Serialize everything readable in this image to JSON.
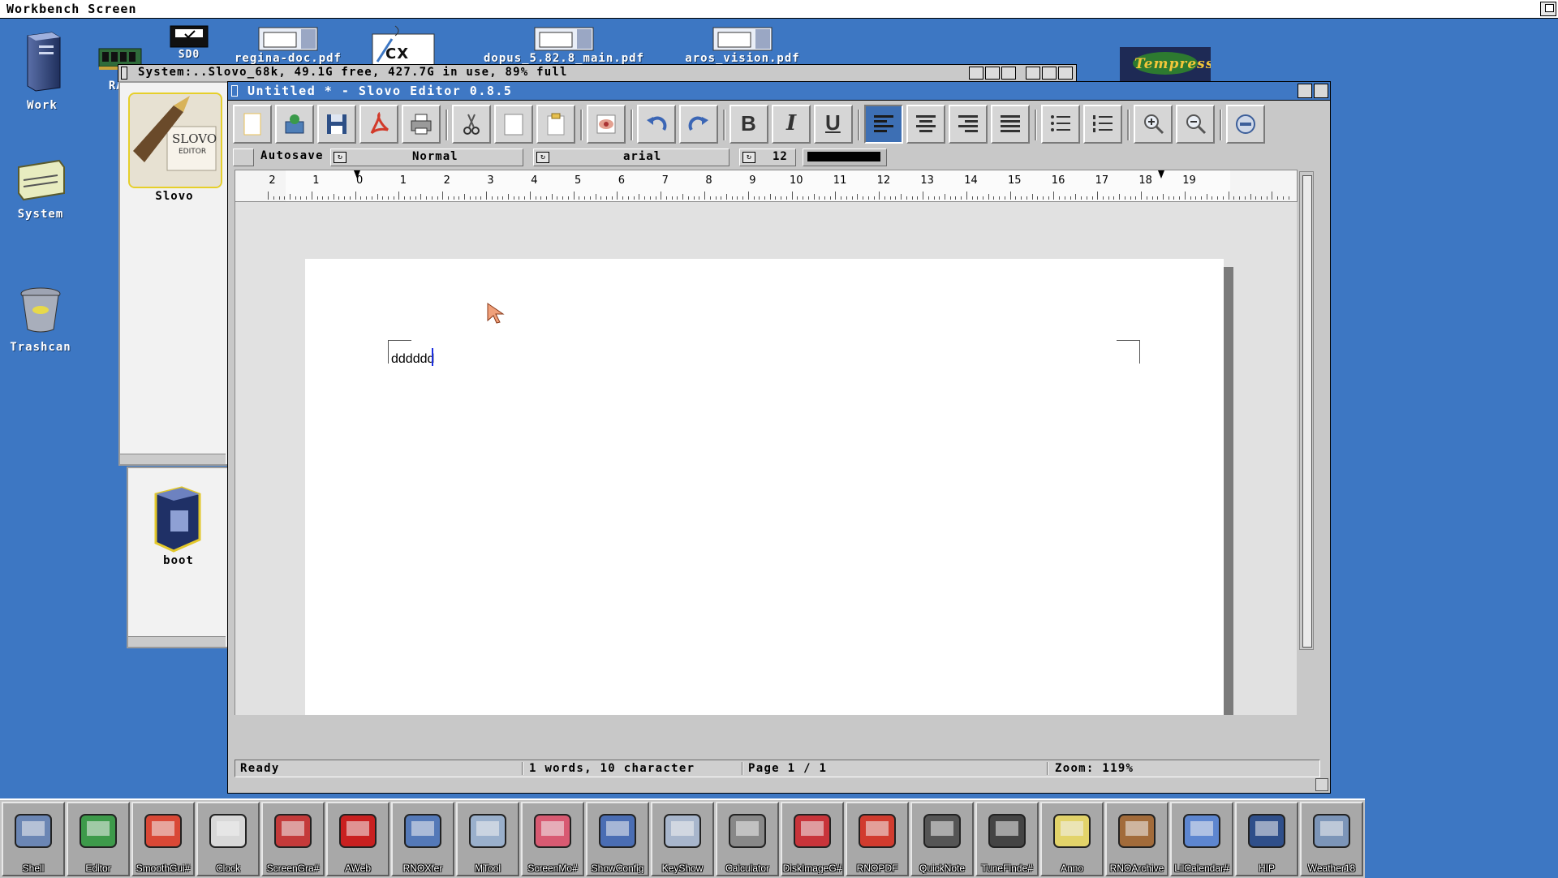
{
  "screen": {
    "title": "Workbench Screen"
  },
  "desktop": {
    "icons": [
      {
        "name": "work",
        "label": "Work"
      },
      {
        "name": "ram",
        "label": "RAM"
      },
      {
        "name": "system",
        "label": "System"
      },
      {
        "name": "trashcan",
        "label": "Trashcan"
      },
      {
        "name": "sd0",
        "label": "SD0"
      },
      {
        "name": "regina-doc",
        "label": "regina-doc.pdf"
      },
      {
        "name": "cx",
        "label": ""
      },
      {
        "name": "dopus",
        "label": "dopus_5.82.8_main.pdf"
      },
      {
        "name": "aros-vision",
        "label": "aros_vision.pdf"
      },
      {
        "name": "tempress",
        "label": "Tempress"
      }
    ]
  },
  "system_window": {
    "title": "System:..Slovo_68k,  49.1G free, 427.7G in use, 89% full"
  },
  "drawers": {
    "slovo": {
      "label": "Slovo",
      "icon_text_top": "SLOVO",
      "icon_text_bottom": "EDITOR"
    },
    "boot": {
      "label": "boot"
    }
  },
  "editor": {
    "title": "Untitled * - Slovo Editor 0.8.5",
    "toolbar": [
      "new-doc-icon",
      "open-icon",
      "save-icon",
      "export-pdf-icon",
      "print-icon",
      "cut-icon",
      "copy-icon",
      "paste-icon",
      "preview-icon",
      "undo-icon",
      "redo-icon",
      "bold-icon",
      "italic-icon",
      "underline-icon",
      "align-left-icon",
      "align-center-icon",
      "align-right-icon",
      "align-justify-icon",
      "bullet-list-icon",
      "numbered-list-icon",
      "zoom-in-icon",
      "zoom-out-icon",
      "settings-icon"
    ],
    "toolbar_glyphs": {
      "bold": "B",
      "italic": "I",
      "underline": "U"
    },
    "format": {
      "autosave_label": "Autosave",
      "style_value": "Normal",
      "font_value": "arial",
      "size_value": "12",
      "text_color": "#000000"
    },
    "ruler": {
      "negative_labels": [
        "2",
        "1"
      ],
      "labels": [
        "0",
        "1",
        "2",
        "3",
        "4",
        "5",
        "6",
        "7",
        "8",
        "9",
        "10",
        "11",
        "12",
        "13",
        "14",
        "15",
        "16",
        "17",
        "18",
        "19"
      ]
    },
    "document": {
      "text": "dddddd"
    },
    "scroll": {
      "up": "∧",
      "down": "V"
    },
    "status": {
      "state": "Ready",
      "counts": "1 words, 10 character",
      "page": "Page 1 / 1",
      "zoom": "Zoom: 119%"
    }
  },
  "dock": {
    "items": [
      {
        "label": "Shell",
        "icon": "shell-icon"
      },
      {
        "label": "Editor",
        "icon": "editor-icon"
      },
      {
        "label": "SmoothGui#",
        "icon": "smoothgui-icon"
      },
      {
        "label": "Clock",
        "icon": "clock-icon"
      },
      {
        "label": "ScreenGra#",
        "icon": "screengrab-icon"
      },
      {
        "label": "AWeb",
        "icon": "aweb-icon"
      },
      {
        "label": "RNOXfer",
        "icon": "rnoxfer-icon"
      },
      {
        "label": "MTool",
        "icon": "mtool-icon"
      },
      {
        "label": "ScreenMo#",
        "icon": "screenmode-icon"
      },
      {
        "label": "ShowConfig",
        "icon": "showconfig-icon"
      },
      {
        "label": "KeyShow",
        "icon": "keyshow-icon"
      },
      {
        "label": "Calculator",
        "icon": "calculator-icon"
      },
      {
        "label": "DiskImageG#",
        "icon": "diskimage-icon"
      },
      {
        "label": "RNOPDF",
        "icon": "rnopdf-icon"
      },
      {
        "label": "QuickNote",
        "icon": "quicknote-icon"
      },
      {
        "label": "TuneFinde#",
        "icon": "tunefinder-icon"
      },
      {
        "label": "Anno",
        "icon": "anno-icon"
      },
      {
        "label": "RNOArchive",
        "icon": "rnoarchive-icon"
      },
      {
        "label": "LilCalendar#",
        "icon": "lilcalendar-icon"
      },
      {
        "label": "HIP",
        "icon": "hip-icon"
      },
      {
        "label": "Weather18",
        "icon": "weather-icon"
      }
    ]
  }
}
